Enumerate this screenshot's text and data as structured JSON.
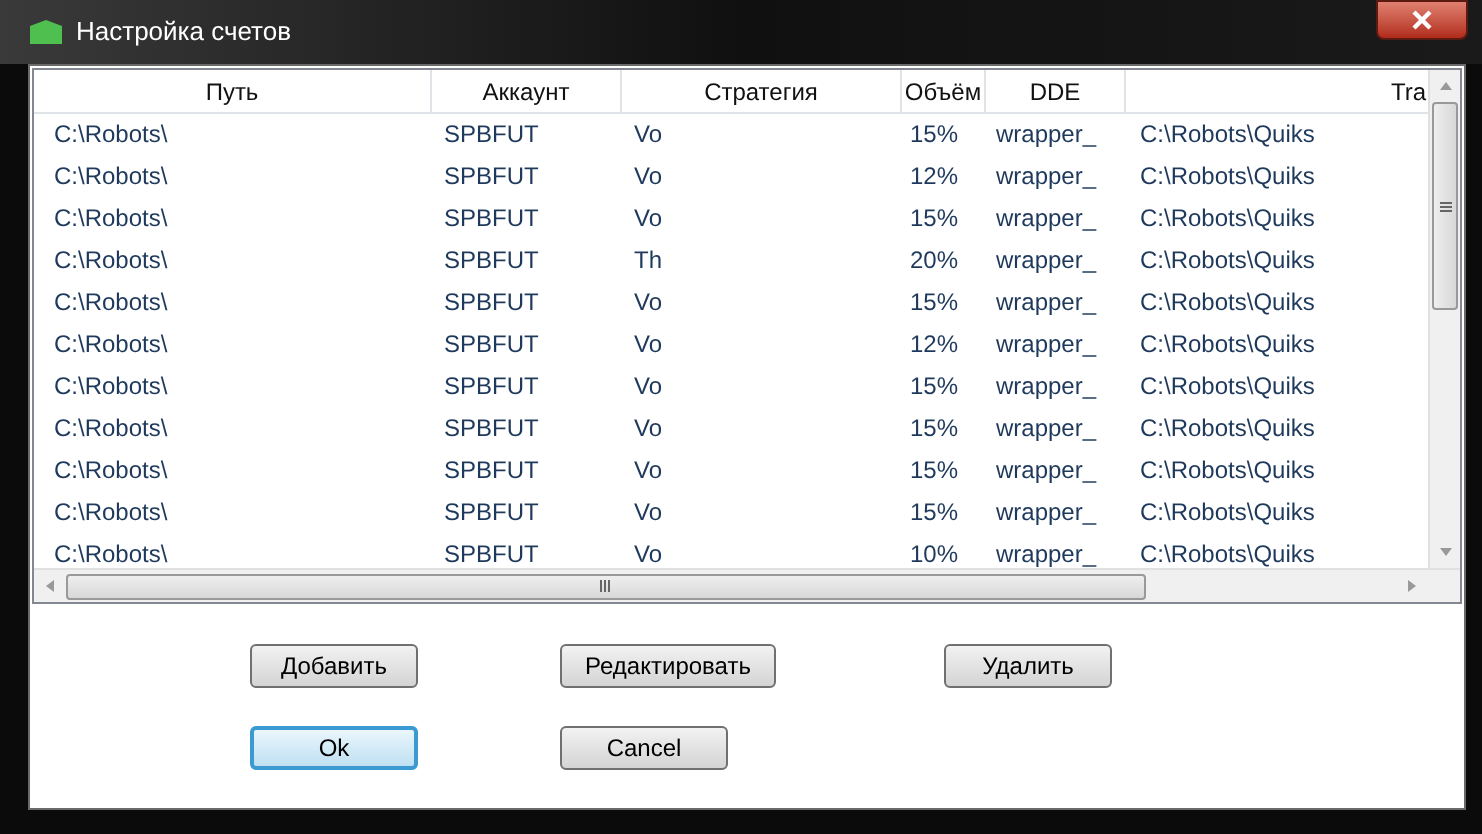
{
  "window": {
    "title": "Настройка счетов"
  },
  "table": {
    "columns": [
      "Путь",
      "Аккаунт",
      "Стратегия",
      "Объём",
      "DDE",
      "Tra"
    ],
    "rows": [
      [
        "C:\\Robots\\",
        "SPBFUT",
        "Vo",
        "15%",
        "wrapper_",
        "C:\\Robots\\Quiks"
      ],
      [
        "C:\\Robots\\",
        "SPBFUT",
        "Vo",
        "12%",
        "wrapper_",
        "C:\\Robots\\Quiks"
      ],
      [
        "C:\\Robots\\",
        "SPBFUT",
        "Vo",
        "15%",
        "wrapper_",
        "C:\\Robots\\Quiks"
      ],
      [
        "C:\\Robots\\",
        "SPBFUT",
        "Th",
        "20%",
        "wrapper_",
        "C:\\Robots\\Quiks"
      ],
      [
        "C:\\Robots\\",
        "SPBFUT",
        "Vo",
        "15%",
        "wrapper_",
        "C:\\Robots\\Quiks"
      ],
      [
        "C:\\Robots\\",
        "SPBFUT",
        "Vo",
        "12%",
        "wrapper_",
        "C:\\Robots\\Quiks"
      ],
      [
        "C:\\Robots\\",
        "SPBFUT",
        "Vo",
        "15%",
        "wrapper_",
        "C:\\Robots\\Quiks"
      ],
      [
        "C:\\Robots\\",
        "SPBFUT",
        "Vo",
        "15%",
        "wrapper_",
        "C:\\Robots\\Quiks"
      ],
      [
        "C:\\Robots\\",
        "SPBFUT",
        "Vo",
        "15%",
        "wrapper_",
        "C:\\Robots\\Quiks"
      ],
      [
        "C:\\Robots\\",
        "SPBFUT",
        "Vo",
        "15%",
        "wrapper_",
        "C:\\Robots\\Quiks"
      ],
      [
        "C:\\Robots\\",
        "SPBFUT",
        "Vo",
        "10%",
        "wrapper_",
        "C:\\Robots\\Quiks"
      ]
    ]
  },
  "buttons": [
    [
      {
        "label": "Добавить",
        "focused": false
      },
      {
        "label": "Редактировать",
        "focused": false
      },
      {
        "label": "Удалить",
        "focused": false
      }
    ],
    [
      {
        "label": "Ok",
        "focused": true
      },
      {
        "label": "Cancel",
        "focused": false
      }
    ]
  ]
}
